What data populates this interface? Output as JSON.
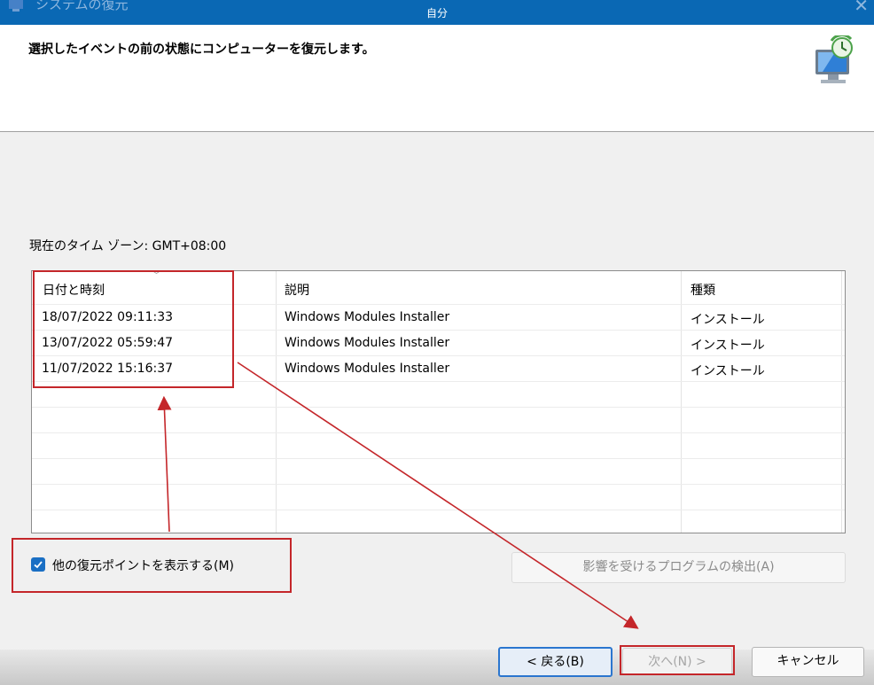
{
  "window": {
    "title": "システムの復元",
    "watermark": "自分",
    "icon": "system-restore-icon",
    "close_icon": "close-icon"
  },
  "header": {
    "instruction": "選択したイベントの前の状態にコンピューターを復元します。",
    "icon": "restore-monitor-icon"
  },
  "timezone": "現在のタイム ゾーン: GMT+08:00",
  "table": {
    "columns": [
      "日付と時刻",
      "説明",
      "種類"
    ],
    "rows": [
      [
        "18/07/2022 09:11:33",
        "Windows Modules Installer",
        "インストール"
      ],
      [
        "13/07/2022 05:59:47",
        "Windows Modules Installer",
        "インストール"
      ],
      [
        "11/07/2022 15:16:37",
        "Windows Modules Installer",
        "インストール"
      ]
    ]
  },
  "show_more": {
    "label": "他の復元ポイントを表示する(M)",
    "checked": true
  },
  "buttons": {
    "scan": "影響を受けるプログラムの検出(A)",
    "back": "< 戻る(B)",
    "next": "次へ(N) >",
    "cancel": "キャンセル"
  },
  "colors": {
    "titlebar": "#0a68b4",
    "accent": "#1a6fc4",
    "annotation": "#c4262a"
  }
}
